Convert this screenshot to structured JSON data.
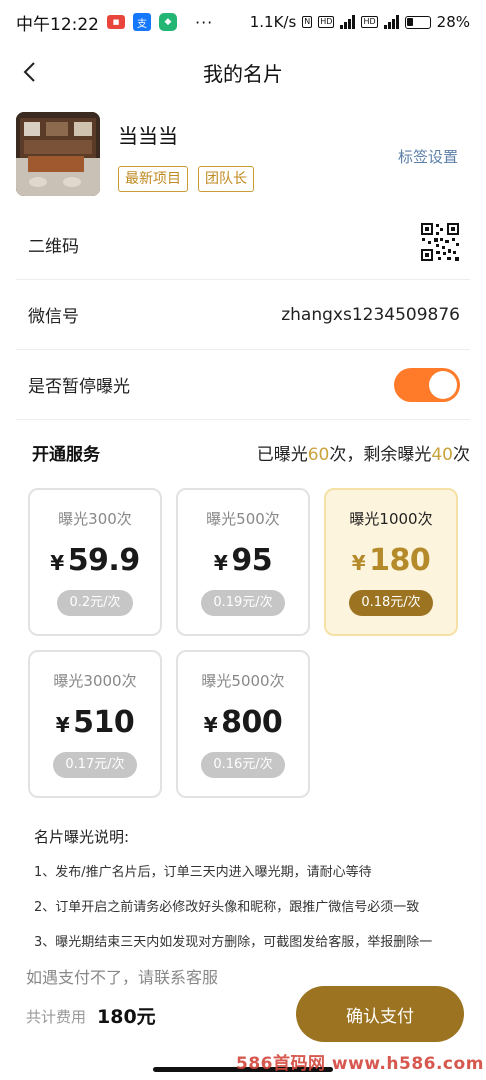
{
  "status_bar": {
    "time": "中午12:22",
    "net_speed": "1.1K/s",
    "battery_percent": "28%",
    "battery_level": 0.28
  },
  "nav": {
    "title": "我的名片"
  },
  "profile": {
    "name": "当当当",
    "tags": [
      "最新项目",
      "团队长"
    ],
    "tag_settings_label": "标签设置"
  },
  "rows": {
    "qrcode_label": "二维码",
    "wechat_label": "微信号",
    "wechat_value": "zhangxs1234509876",
    "pause_label": "是否暂停曝光",
    "pause_on": true
  },
  "service": {
    "title": "开通服务",
    "exposure_prefix": "已曝光",
    "exposed_count": "60",
    "exposure_mid": "次，剩余曝光",
    "remaining_count": "40",
    "exposure_suffix": "次"
  },
  "plans": [
    {
      "title": "曝光300次",
      "currency": "¥",
      "price": "59.9",
      "unit_price": "0.2元/次",
      "selected": false
    },
    {
      "title": "曝光500次",
      "currency": "¥",
      "price": "95",
      "unit_price": "0.19元/次",
      "selected": false
    },
    {
      "title": "曝光1000次",
      "currency": "¥",
      "price": "180",
      "unit_price": "0.18元/次",
      "selected": true
    },
    {
      "title": "曝光3000次",
      "currency": "¥",
      "price": "510",
      "unit_price": "0.17元/次",
      "selected": false
    },
    {
      "title": "曝光5000次",
      "currency": "¥",
      "price": "800",
      "unit_price": "0.16元/次",
      "selected": false
    }
  ],
  "notes": {
    "title": "名片曝光说明:",
    "items": [
      "1、发布/推广名片后，订单三天内进入曝光期，请耐心等待",
      "2、订单开启之前请务必修改好头像和昵称，跟推广微信号必须一致",
      "3、曝光期结束三天内如发现对方删除，可截图发给客服，举报删除一"
    ]
  },
  "footer": {
    "contact_text": "如遇支付不了，请联系客服",
    "total_label": "共计费用",
    "total_value": "180元",
    "pay_button": "确认支付"
  },
  "watermark": "586首码网 www.h586.com",
  "colors": {
    "accent_gold": "#9c7421",
    "price_gold": "#b58a2a",
    "toggle_orange": "#ff7a29",
    "link_blue": "#5c7fa8"
  }
}
